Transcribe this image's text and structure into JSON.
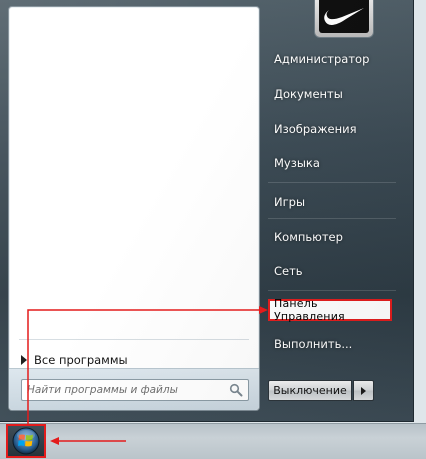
{
  "start_menu": {
    "all_programs_label": "Все программы",
    "search": {
      "placeholder": "Найти программы и файлы"
    },
    "right_items": [
      {
        "label": "Администратор"
      },
      {
        "label": "Документы"
      },
      {
        "label": "Изображения"
      },
      {
        "label": "Музыка"
      },
      {
        "label": "Игры"
      },
      {
        "label": "Компьютер"
      },
      {
        "label": "Сеть"
      },
      {
        "label": "Панель  Управления"
      },
      {
        "label": "Выполнить..."
      }
    ],
    "shutdown_label": "Выключение"
  },
  "colors": {
    "highlight_red": "#e31c1c",
    "menu_glass": "#3a4953",
    "taskbar": "#c3ccd1"
  },
  "icons": {
    "user_picture": "swoosh-logo-icon",
    "search": "magnifier-icon",
    "start": "windows-logo-icon"
  }
}
